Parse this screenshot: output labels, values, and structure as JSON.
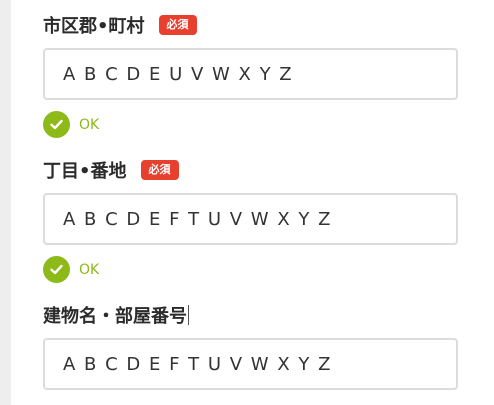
{
  "required_badge": "必須",
  "fields": [
    {
      "label": "市区郡•町村",
      "required": true,
      "value": "A B C D E U V W X Y Z",
      "status": "OK"
    },
    {
      "label": "丁目•番地",
      "required": true,
      "value": "A B C D E F T U V W X Y Z",
      "status": "OK"
    },
    {
      "label": "建物名・部屋番号",
      "required": false,
      "value": "A B C D E F T U V W X Y Z"
    }
  ],
  "colors": {
    "required_badge": "#e8402f",
    "ok": "#8db919",
    "input_border": "#dcdcdc"
  },
  "icons": {
    "status": "check-circle-icon"
  }
}
